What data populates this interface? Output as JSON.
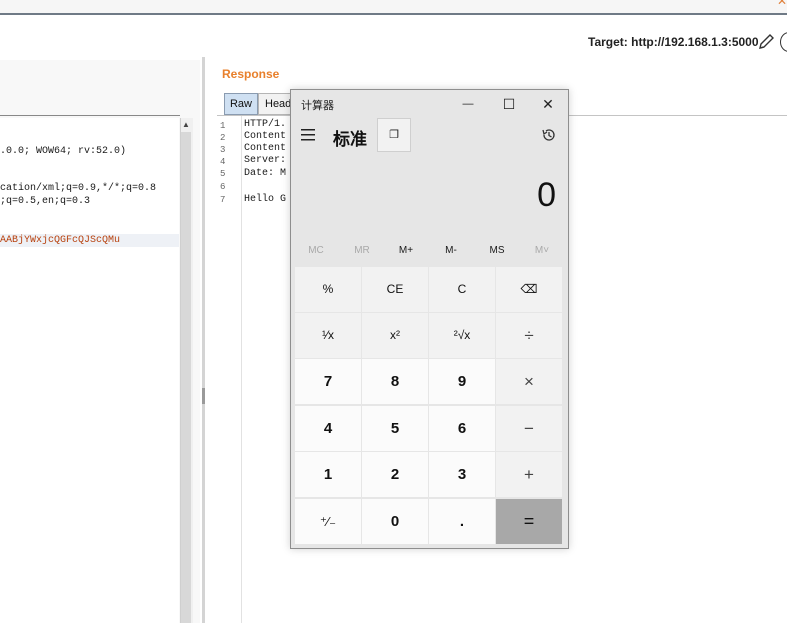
{
  "header": {
    "target_label": "Target: http://192.168.1.3:5000",
    "corner_glyph": "✕"
  },
  "request": {
    "lines": [
      ".0.0; WOW64; rv:52.0)",
      "cation/xml;q=0.9,*/*;q=0.8",
      ";q=0.5,en;q=0.3",
      "AABjYWxjcQGFcQJScQMu"
    ]
  },
  "response": {
    "title": "Response",
    "tabs": [
      "Raw",
      "Head"
    ],
    "line_numbers": [
      "1",
      "2",
      "3",
      "4",
      "5",
      "6",
      "7"
    ],
    "lines": [
      "HTTP/1.",
      "Content",
      "Content",
      "Server:",
      "Date: M",
      "",
      "Hello G"
    ]
  },
  "calculator": {
    "window_title": "计算器",
    "mode": "标准",
    "keep_on_top": "❐",
    "display": "0",
    "memory": [
      "MC",
      "MR",
      "M+",
      "M-",
      "MS",
      "M˅"
    ],
    "keys": [
      [
        "%",
        "CE",
        "C",
        "⌫"
      ],
      [
        "¹⁄x",
        "x²",
        "²√x",
        "÷"
      ],
      [
        "7",
        "8",
        "9",
        "×"
      ],
      [
        "4",
        "5",
        "6",
        "−"
      ],
      [
        "1",
        "2",
        "3",
        "+"
      ],
      [
        "⁺⁄₋",
        "0",
        ".",
        "="
      ]
    ],
    "minimize": "—",
    "maximize": "☐",
    "close": "✕"
  }
}
